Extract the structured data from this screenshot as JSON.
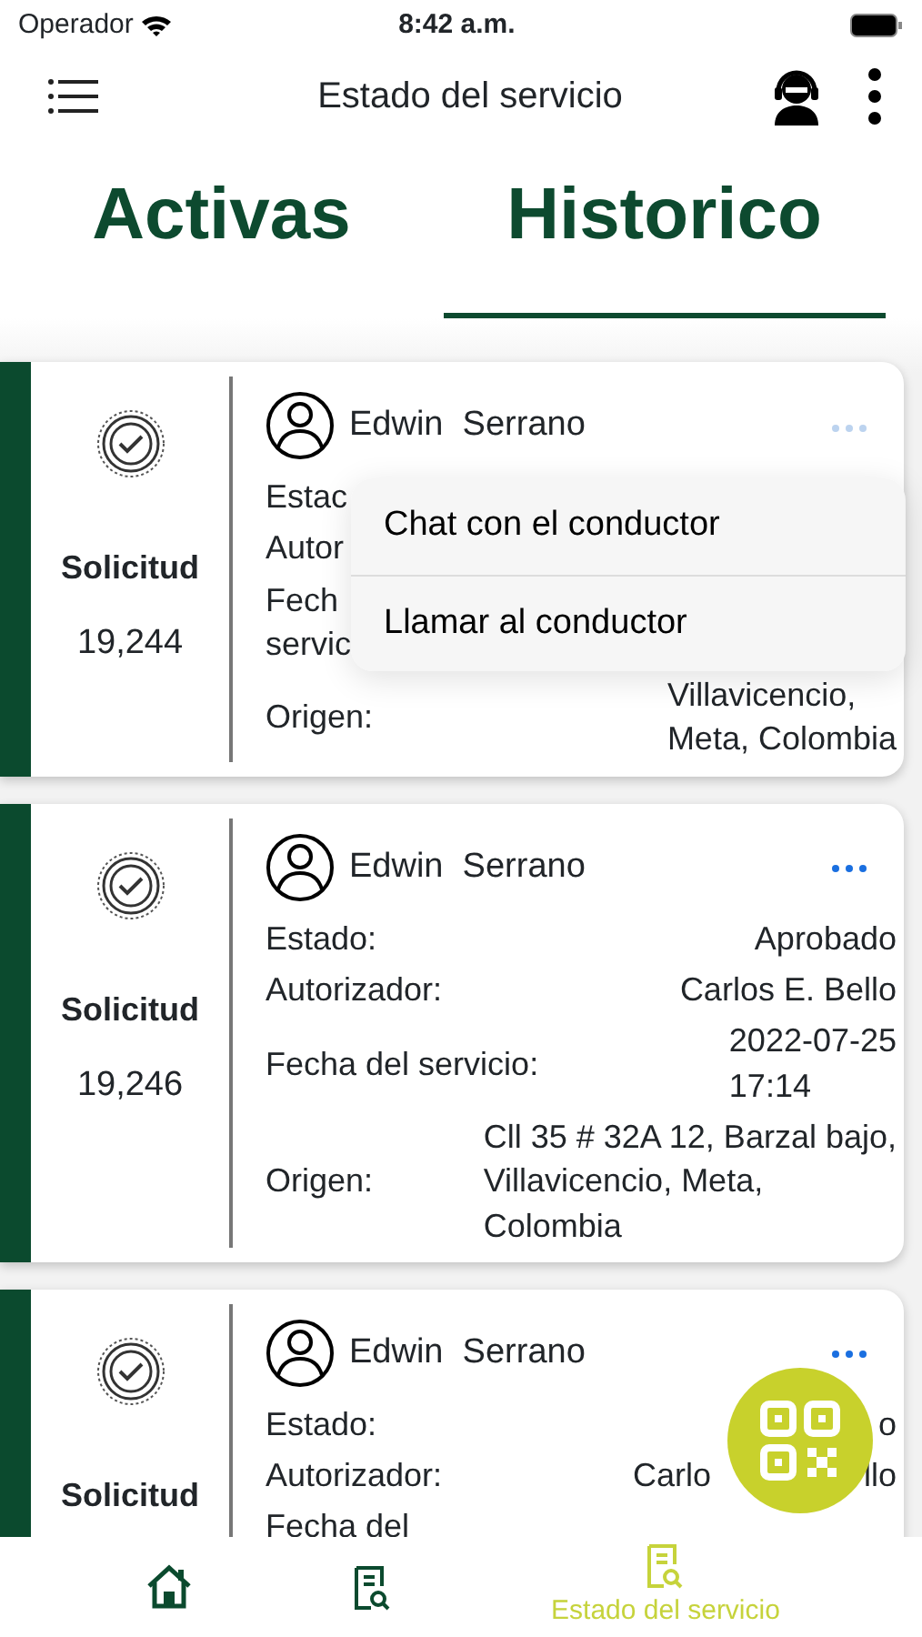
{
  "status_bar": {
    "carrier": "Operador",
    "time": "8:42 a.m."
  },
  "header": {
    "title": "Estado del servicio"
  },
  "tabs": [
    {
      "label": "Activas",
      "selected": false
    },
    {
      "label": "Historico",
      "selected": true
    }
  ],
  "cards": [
    {
      "heading": "Solicitud",
      "number": "19,244",
      "name": "Edwin  Serrano",
      "menu_open": true,
      "fields": [
        {
          "label": "Estac"
        },
        {
          "label": "Autor"
        },
        {
          "label": "Fech\nservic"
        },
        {
          "label": "Origen:",
          "value": "Villavicencio,\nMeta, Colombia"
        }
      ]
    },
    {
      "heading": "Solicitud",
      "number": "19,246",
      "name": "Edwin  Serrano",
      "menu_open": false,
      "fields": [
        {
          "label": "Estado:",
          "value": "Aprobado"
        },
        {
          "label": "Autorizador:",
          "value": "Carlos E. Bello"
        },
        {
          "label": "Fecha del servicio:",
          "value": "2022-07-25\n17:14"
        },
        {
          "label": "Origen:",
          "value": "Cll 35 # 32A 12, Barzal bajo,\nVillavicencio, Meta,\nColombia"
        }
      ]
    },
    {
      "heading": "Solicitud",
      "name": "Edwin  Serrano",
      "menu_open": false,
      "fields": [
        {
          "label": "Estado:",
          "value_parts": [
            "o"
          ]
        },
        {
          "label": "Autorizador:",
          "value_parts": [
            "Carlo",
            "llo"
          ]
        },
        {
          "label": "Fecha del"
        }
      ]
    }
  ],
  "context_menu": {
    "items": [
      "Chat con el conductor",
      "Llamar al conductor"
    ]
  },
  "bottom_nav": [
    {
      "selected": false
    },
    {
      "selected": false
    },
    {
      "label": "Estado del servicio",
      "selected": true
    }
  ]
}
